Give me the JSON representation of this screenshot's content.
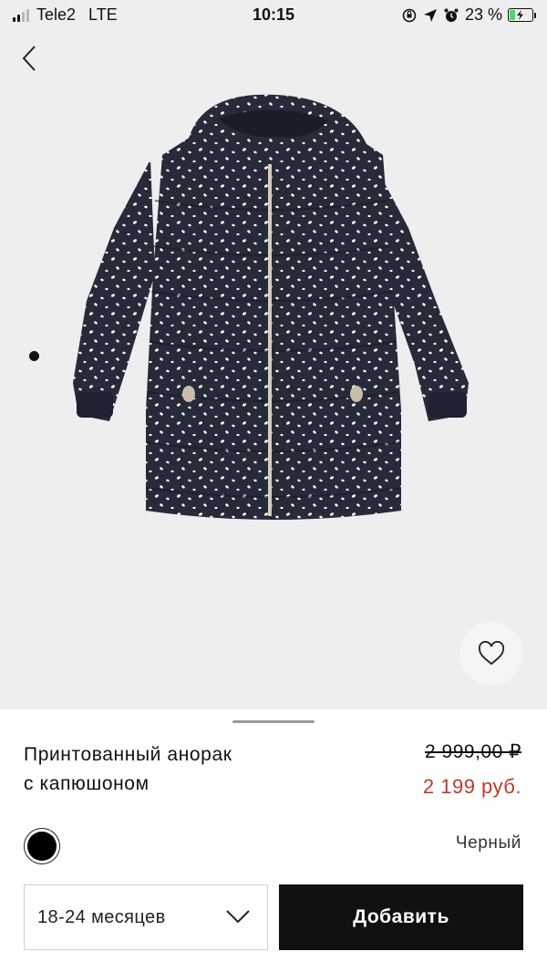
{
  "status_bar": {
    "carrier": "Tele2",
    "network": "LTE",
    "time": "10:15",
    "battery_percent": "23 %",
    "battery_level": 0.23,
    "icons": [
      "screen-lock-rotation-icon",
      "location-arrow-icon",
      "alarm-icon",
      "battery-charging-icon"
    ]
  },
  "product_image": {
    "image": "navy-polka-dot-hooded-puffer-jacket",
    "colors": {
      "background": "#eeeeee",
      "jacket": "#262a39",
      "dots": "#ffffff",
      "zipper": "#d9cdb8"
    }
  },
  "product": {
    "title_line1": "Принтованный анорак",
    "title_line2": "с капюшоном",
    "old_price": "2 999,00 ₽",
    "new_price": "2 199 руб.",
    "color_name": "Черный",
    "swatch_color": "#000000",
    "sale_color": "#c0392b"
  },
  "actions": {
    "size_value": "18-24 месяцев",
    "add_label": "Добавить"
  }
}
